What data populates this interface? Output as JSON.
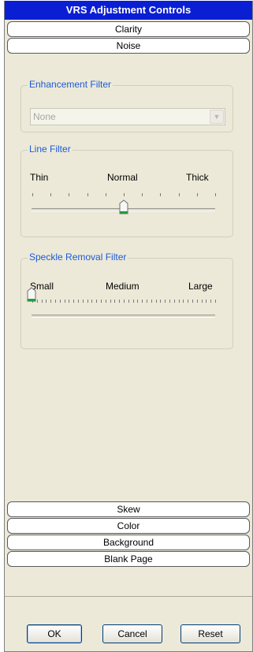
{
  "panel": {
    "title": "VRS Adjustment Controls"
  },
  "groups_top": {
    "clarity": "Clarity",
    "noise": "Noise"
  },
  "enhancement_filter": {
    "legend": "Enhancement Filter",
    "selected": "None"
  },
  "line_filter": {
    "legend": "Line Filter",
    "labels": [
      "Thin",
      "Normal",
      "Thick"
    ],
    "value": "Normal",
    "position_fraction": 0.5
  },
  "speckle_filter": {
    "legend": "Speckle Removal Filter",
    "labels": [
      "Small",
      "Medium",
      "Large"
    ],
    "position_fraction": 0.0
  },
  "groups_bottom": {
    "skew": "Skew",
    "color": "Color",
    "background": "Background",
    "blank_page": "Blank Page"
  },
  "buttons": {
    "ok": "OK",
    "cancel": "Cancel",
    "reset": "Reset"
  },
  "colors": {
    "title_bar": "#0a1fd4",
    "legend_text": "#1c5bd6",
    "panel_bg": "#ece9d8",
    "thumb_accent": "#1e9e3a"
  }
}
